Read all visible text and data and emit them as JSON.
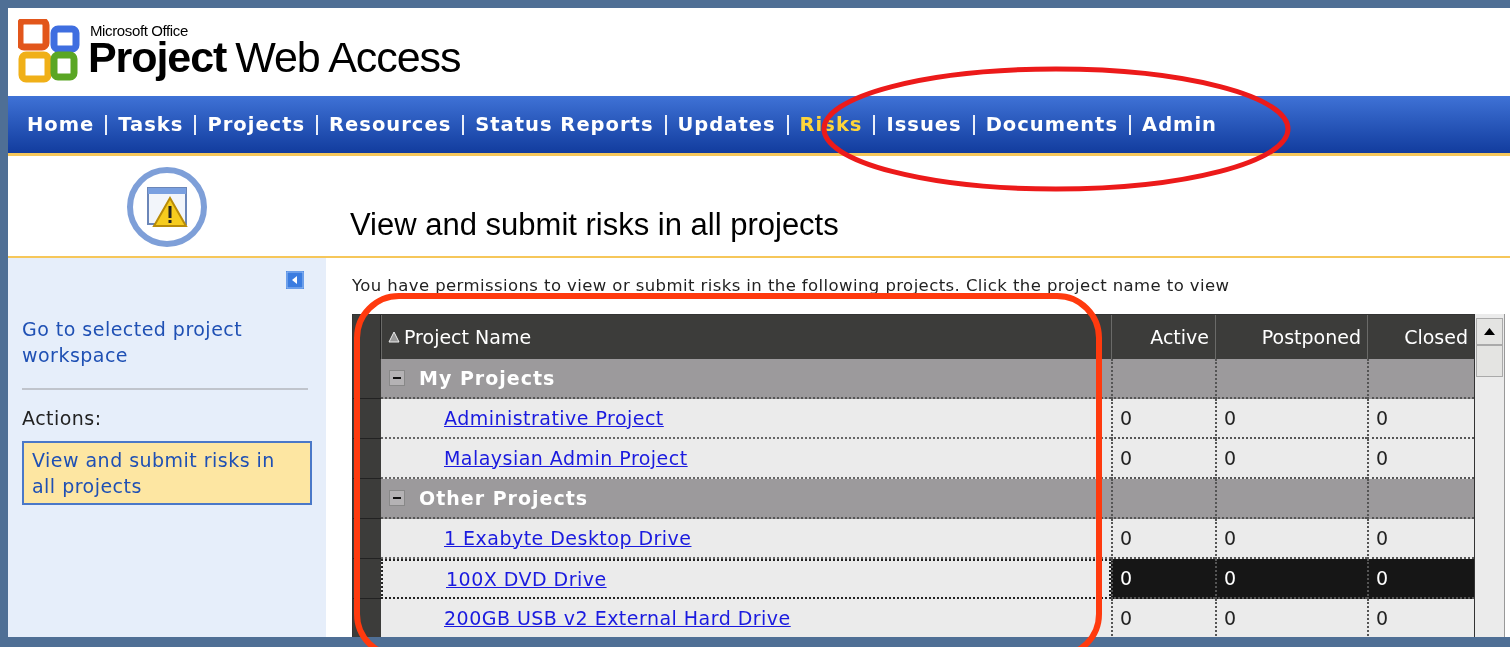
{
  "logo": {
    "brand": "Microsoft Office",
    "product_bold": "Project",
    "product": "Web Access"
  },
  "nav": [
    {
      "label": "Home",
      "selected": false
    },
    {
      "label": "Tasks",
      "selected": false
    },
    {
      "label": "Projects",
      "selected": false
    },
    {
      "label": "Resources",
      "selected": false
    },
    {
      "label": "Status Reports",
      "selected": false
    },
    {
      "label": "Updates",
      "selected": false
    },
    {
      "label": "Risks",
      "selected": true
    },
    {
      "label": "Issues",
      "selected": false
    },
    {
      "label": "Documents",
      "selected": false
    },
    {
      "label": "Admin",
      "selected": false
    }
  ],
  "page_title": "View and submit risks in all projects",
  "sidebar": {
    "link": "Go to selected project workspace",
    "actions_label": "Actions:",
    "actions": [
      {
        "label": "View and submit risks in all projects",
        "selected": true
      }
    ]
  },
  "intro": "You have permissions to view or submit risks in the following projects. Click the project name to view",
  "table": {
    "columns": [
      {
        "label": "Project Name",
        "sorted": true
      },
      {
        "label": "Active",
        "sorted": false
      },
      {
        "label": "Postponed",
        "sorted": false
      },
      {
        "label": "Closed",
        "sorted": false
      }
    ],
    "groups": [
      {
        "name": "My Projects",
        "expanded": true,
        "rows": [
          {
            "name": "Administrative Project",
            "active": "0",
            "postponed": "0",
            "closed": "0",
            "selected": false
          },
          {
            "name": "Malaysian Admin Project",
            "active": "0",
            "postponed": "0",
            "closed": "0",
            "selected": false
          }
        ]
      },
      {
        "name": "Other Projects",
        "expanded": true,
        "rows": [
          {
            "name": "1 Exabyte Desktop Drive",
            "active": "0",
            "postponed": "0",
            "closed": "0",
            "selected": false
          },
          {
            "name": "100X DVD Drive",
            "active": "0",
            "postponed": "0",
            "closed": "0",
            "selected": true
          },
          {
            "name": "200GB USB v2 External Hard Drive",
            "active": "0",
            "postponed": "0",
            "closed": "0",
            "selected": false
          }
        ]
      }
    ]
  }
}
